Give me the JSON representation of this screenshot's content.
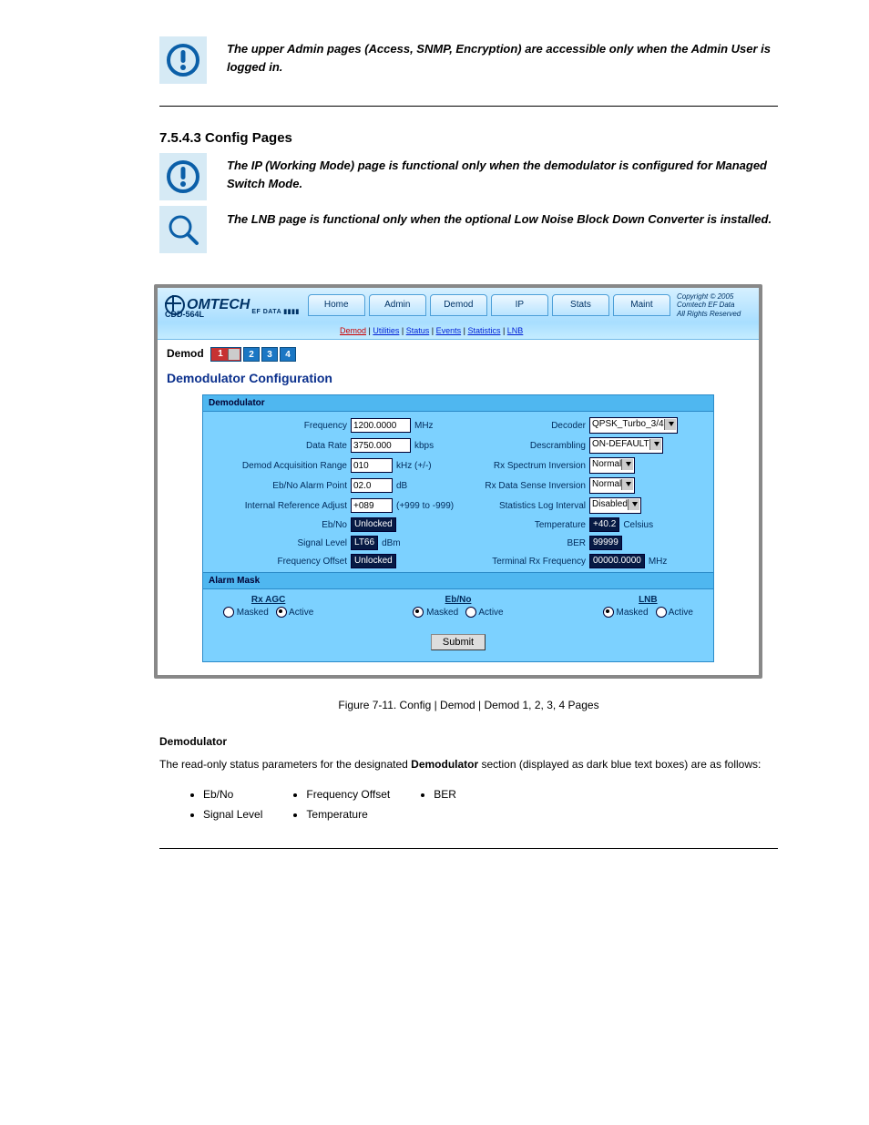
{
  "intro_text_prefix": "The upper ",
  "intro_text_strong1": "Admin",
  "intro_text_mid": " pages (Access, SNMP, Encryption) are accessible only when the ",
  "intro_text_strong2": "Admin User",
  "intro_text_end": " is logged in.",
  "section_number_heading": "7.5.4.3 Config Pages",
  "note2_text_prefix": "The ",
  "note2_text_strong1": "IP (Working Mode)",
  "note2_text_mid1": " page is functional only when the demodulator is configured for ",
  "note2_text_strong2": "Managed Switch Mode",
  "note2_text_period": ".",
  "note2_text2_prefix": "The ",
  "note2_text2_strong": "LNB",
  "note2_text2_rest": " page is functional only when the optional Low Noise Block Down Converter is installed.",
  "product": "CDD-564L",
  "tabs": [
    "Home",
    "Admin",
    "Demod",
    "IP",
    "Stats",
    "Maint"
  ],
  "copyright": "Copyright © 2005\nComtech EF Data\nAll Rights Reserved",
  "subnav": {
    "active": "Demod",
    "items": [
      "Utilities",
      "Status",
      "Events",
      "Statistics",
      "LNB"
    ]
  },
  "demod_label": "Demod",
  "demod_nums": [
    "1",
    "2",
    "3",
    "4"
  ],
  "page_title": "Demodulator Configuration",
  "panel1_title": "Demodulator",
  "left_rows": [
    {
      "lbl": "Frequency",
      "val": "1200.0000",
      "unit": "MHz",
      "type": "input",
      "w": "w60"
    },
    {
      "lbl": "Data Rate",
      "val": "3750.000",
      "unit": "kbps",
      "type": "input",
      "w": "w60"
    },
    {
      "lbl": "Demod Acquisition Range",
      "val": "010",
      "unit": "kHz (+/-)",
      "type": "input",
      "w": "w40"
    },
    {
      "lbl": "Eb/No Alarm Point",
      "val": "02.0",
      "unit": "dB",
      "type": "input",
      "w": "w40"
    },
    {
      "lbl": "Internal Reference Adjust",
      "val": "+089",
      "unit": "(+999 to -999)",
      "type": "input",
      "w": "w40"
    },
    {
      "lbl": "Eb/No",
      "val": "Unlocked",
      "unit": "",
      "type": "ro"
    },
    {
      "lbl": "Signal Level",
      "val": "LT66",
      "unit": "dBm",
      "type": "ro"
    },
    {
      "lbl": "Frequency Offset",
      "val": "Unlocked",
      "unit": "",
      "type": "ro"
    }
  ],
  "right_rows": [
    {
      "lbl": "Decoder",
      "val": "QPSK_Turbo_3/4",
      "type": "select"
    },
    {
      "lbl": "Descrambling",
      "val": "ON-DEFAULT",
      "type": "select"
    },
    {
      "lbl": "Rx Spectrum Inversion",
      "val": "Normal",
      "type": "select"
    },
    {
      "lbl": "Rx Data Sense Inversion",
      "val": "Normal",
      "type": "select"
    },
    {
      "lbl": "Statistics Log Interval",
      "val": "Disabled",
      "type": "select"
    },
    {
      "lbl": "Temperature",
      "val": "+40.2",
      "unit": "Celsius",
      "type": "ro"
    },
    {
      "lbl": "BER",
      "val": "99999",
      "unit": "",
      "type": "ro"
    },
    {
      "lbl": "Terminal Rx Frequency",
      "val": "00000.0000",
      "unit": "MHz",
      "type": "ro"
    }
  ],
  "panel2_title": "Alarm Mask",
  "alarm_groups": [
    {
      "title": "Rx AGC",
      "masked": false,
      "active": true
    },
    {
      "title": "Eb/No",
      "masked": true,
      "active": false
    },
    {
      "title": "LNB",
      "masked": true,
      "active": false
    }
  ],
  "masked_label": "Masked",
  "active_label": "Active",
  "submit_label": "Submit",
  "fig_caption": "Figure 7-11. Config | Demod | Demod 1, 2, 3, 4 Pages",
  "body_heading": "Demodulator",
  "body_para_prefix": "The read-only status parameters for the designated ",
  "body_para_strong": "Demodulator",
  "body_para_rest": " section (displayed as dark blue text boxes) are as follows:",
  "bullets": [
    [
      "Eb/No",
      "Signal Level"
    ],
    [
      "Frequency Offset",
      "Temperature"
    ],
    [
      "BER"
    ]
  ]
}
